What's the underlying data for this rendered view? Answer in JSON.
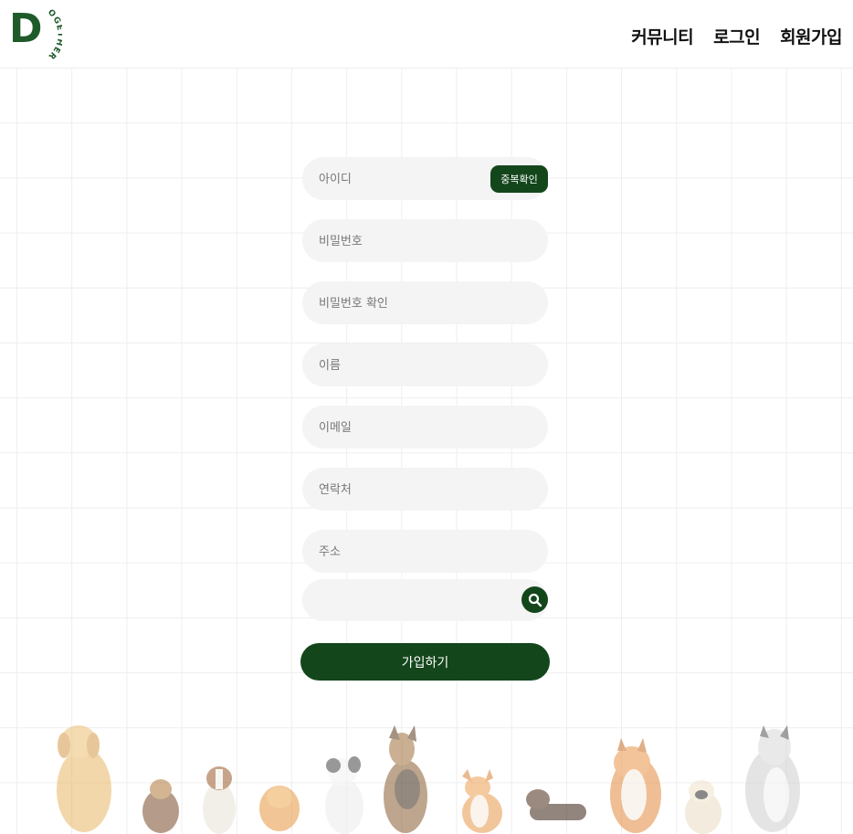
{
  "header": {
    "logo_letter": "D",
    "logo_text": "OGETHER",
    "nav": [
      "커뮤니티",
      "로그인",
      "회원가입"
    ]
  },
  "form": {
    "id_placeholder": "아이디",
    "dup_check_label": "중복확인",
    "password_placeholder": "비밀번호",
    "password_confirm_placeholder": "비밀번호 확인",
    "name_placeholder": "이름",
    "email_placeholder": "이메일",
    "phone_placeholder": "연락처",
    "address_placeholder": "주소",
    "address_detail_placeholder": "",
    "submit_label": "가입하기"
  },
  "colors": {
    "accent": "#14461c",
    "field_bg": "#f4f4f4",
    "grid_line": "#eeeeee"
  },
  "icons": [
    "search-icon"
  ],
  "decoration": {
    "dogs": [
      "golden-retriever",
      "yorkshire-terrier",
      "beagle",
      "pomeranian",
      "cat-like-dog",
      "german-shepherd",
      "corgi",
      "dachshund",
      "shiba-inu",
      "pug",
      "husky"
    ]
  }
}
